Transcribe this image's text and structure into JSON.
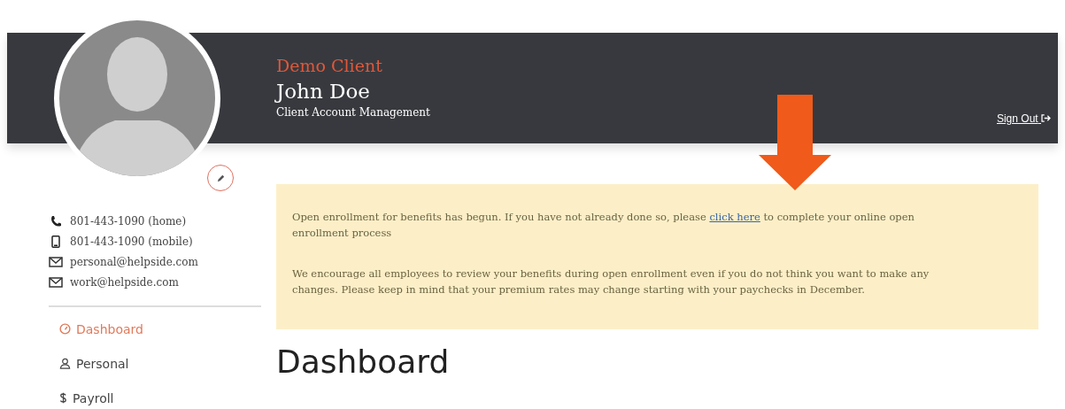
{
  "header": {
    "company": "Demo Client",
    "user_name": "John Doe",
    "subtitle": "Client Account Management",
    "sign_out": "Sign Out"
  },
  "contacts": [
    {
      "kind": "phone",
      "text": "801-443-1090 (home)"
    },
    {
      "kind": "mobile",
      "text": "801-443-1090 (mobile)"
    },
    {
      "kind": "email",
      "text": "personal@helpside.com"
    },
    {
      "kind": "email",
      "text": "work@helpside.com"
    }
  ],
  "nav": [
    {
      "kind": "dashboard",
      "label": "Dashboard",
      "selected": true
    },
    {
      "kind": "person",
      "label": "Personal",
      "selected": false
    },
    {
      "kind": "dollar",
      "label": "Payroll",
      "selected": false
    }
  ],
  "notice": {
    "paragraphs": [
      {
        "before": "Open enrollment for benefits has begun. If you have not already done so, please ",
        "link": "click here",
        "after": " to complete your online open enrollment process"
      },
      {
        "before": "We encourage all employees to review your benefits during open enrollment even if you do not think you want to make any changes. Please keep in mind that your premium rates may change starting with your paychecks in December."
      }
    ]
  },
  "page_title": "Dashboard"
}
